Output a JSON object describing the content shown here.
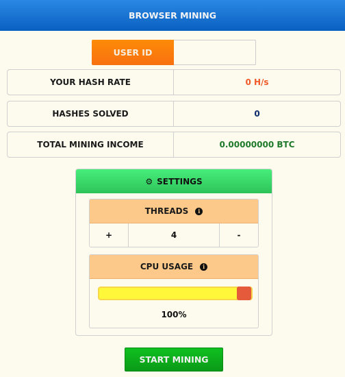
{
  "header": {
    "title": "BROWSER MINING"
  },
  "user_id": {
    "label": "USER ID",
    "value": "",
    "placeholder": ""
  },
  "stats": [
    {
      "label": "YOUR HASH RATE",
      "value": "0 H/s",
      "color": "#f05a28"
    },
    {
      "label": "HASHES SOLVED",
      "value": "0",
      "color": "#0a2a6a"
    },
    {
      "label": "TOTAL MINING INCOME",
      "value": "0.00000000 BTC",
      "color": "#1e7a2a"
    }
  ],
  "settings": {
    "title": "SETTINGS",
    "icon": "gear-icon",
    "threads": {
      "label": "THREADS",
      "plus": "+",
      "value": "4",
      "minus": "-"
    },
    "cpu": {
      "label": "CPU USAGE",
      "percent_text": "100%",
      "value_percent": 100
    }
  },
  "actions": {
    "start_label": "START MINING"
  }
}
